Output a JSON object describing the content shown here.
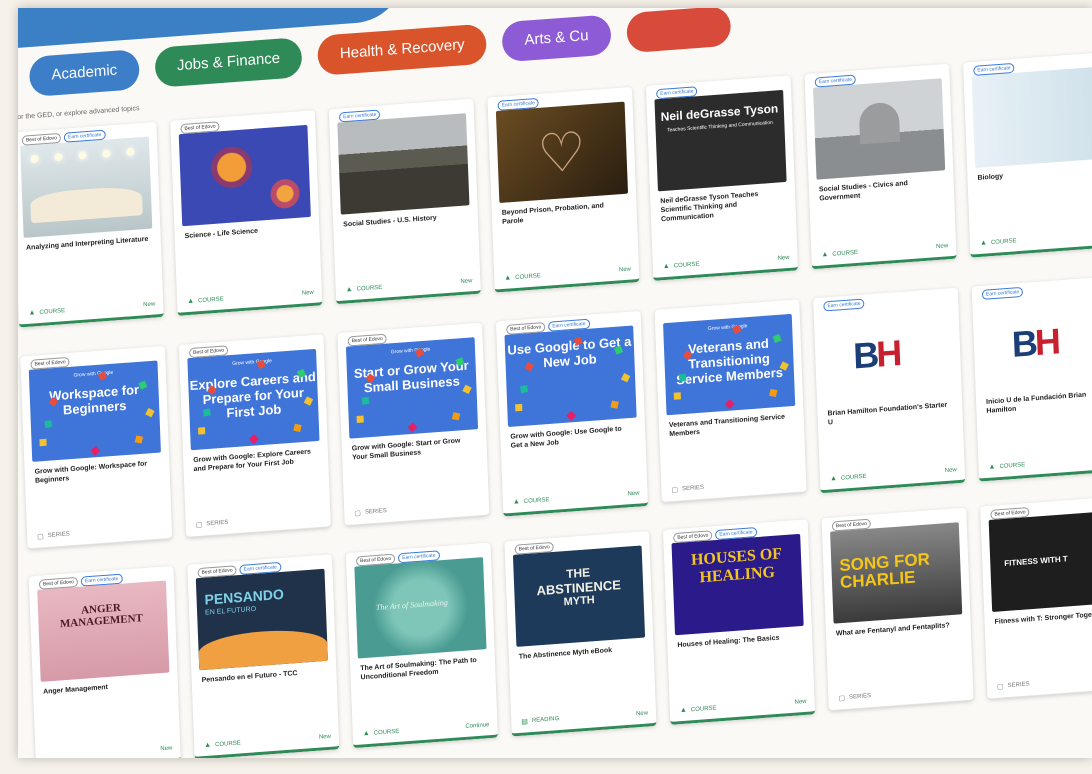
{
  "categories": [
    "Academic",
    "Jobs & Finance",
    "Health & Recovery",
    "Arts & Cu",
    ""
  ],
  "hint": "r for the GED, or explore advanced topics",
  "row1": [
    {
      "badges": [
        "Best of Edovo",
        "Earn certificate"
      ],
      "title": "Analyzing and Interpreting Literature",
      "type": "COURSE",
      "flag": "New",
      "thumb": "book"
    },
    {
      "badges": [
        "Best of Edovo"
      ],
      "title": "Science - Life Science",
      "type": "COURSE",
      "flag": "New",
      "thumb": "life"
    },
    {
      "badges": [
        "Earn certificate"
      ],
      "title": "Social Studies - U.S. History",
      "type": "COURSE",
      "flag": "New",
      "thumb": "crowd"
    },
    {
      "badges": [
        "Earn certificate"
      ],
      "title": "Beyond Prison, Probation, and Parole",
      "type": "COURSE",
      "flag": "New",
      "thumb": "hearts"
    },
    {
      "badges": [
        "Earn certificate"
      ],
      "title": "Neil deGrasse Tyson Teaches Scientific Thinking and Communication",
      "type": "COURSE",
      "flag": "New",
      "thumb": "tyson",
      "thumb_title": "Neil deGrasse Tyson",
      "thumb_sub": "Teaches Scientific Thinking and Communication"
    },
    {
      "badges": [
        "Earn certificate"
      ],
      "title": "Social Studies - Civics and Government",
      "type": "COURSE",
      "flag": "New",
      "thumb": "capitol"
    },
    {
      "badges": [
        "Earn certificate"
      ],
      "title": "Biology",
      "type": "COURSE",
      "flag": "",
      "thumb": "lab"
    }
  ],
  "row2": [
    {
      "badges": [
        "Best of Edovo"
      ],
      "title": "Grow with Google: Workspace for Beginners",
      "type": "SERIES",
      "flag": "",
      "thumb": "google",
      "g_head": "Grow with Google",
      "g_title": "Workspace for Beginners"
    },
    {
      "badges": [
        "Best of Edovo"
      ],
      "title": "Grow with Google: Explore Careers and Prepare for Your First Job",
      "type": "SERIES",
      "flag": "",
      "thumb": "google",
      "g_head": "Grow with Google",
      "g_title": "Explore Careers and Prepare for Your First Job"
    },
    {
      "badges": [
        "Best of Edovo"
      ],
      "title": "Grow with Google: Start or Grow Your Small Business",
      "type": "SERIES",
      "flag": "",
      "thumb": "google",
      "g_head": "Grow with Google",
      "g_title": "Start or Grow Your Small Business"
    },
    {
      "badges": [
        "Best of Edovo",
        "Earn certificate"
      ],
      "title": "Grow with Google: Use Google to Get a New Job",
      "type": "COURSE",
      "flag": "New",
      "thumb": "google",
      "g_head": "",
      "g_title": "Use Google to Get a New Job"
    },
    {
      "badges": [],
      "title": "Veterans and Transitioning Service Members",
      "type": "SERIES",
      "flag": "",
      "thumb": "google",
      "g_head": "Grow with Google",
      "g_title": "Veterans and Transitioning Service Members"
    },
    {
      "badges": [
        "Earn certificate"
      ],
      "title": "Brian Hamilton Foundation's Starter U",
      "type": "COURSE",
      "flag": "New",
      "thumb": "bh"
    },
    {
      "badges": [
        "Earn certificate"
      ],
      "title": "Inicio U de la Fundación Brian Hamilton",
      "type": "COURSE",
      "flag": "",
      "thumb": "bh"
    }
  ],
  "row3": [
    {
      "badges": [
        "Best of Edovo",
        "Earn certificate"
      ],
      "title": "Anger Management",
      "type": "",
      "flag": "New",
      "thumb": "anger",
      "thumb_title": "ANGER MANAGEMENT"
    },
    {
      "badges": [
        "Best of Edovo",
        "Earn certificate"
      ],
      "title": "Pensando en el Futuro - TCC",
      "type": "COURSE",
      "flag": "New",
      "thumb": "futuro",
      "thumb_title": "PENSANDO",
      "thumb_sub": "EN EL FUTURO"
    },
    {
      "badges": [
        "Best of Edovo",
        "Earn certificate"
      ],
      "title": "The Art of Soulmaking: The Path to Unconditional Freedom",
      "type": "COURSE",
      "flag": "Continue",
      "thumb": "soul",
      "thumb_title": "The Art of Soulmaking"
    },
    {
      "badges": [
        "Best of Edovo"
      ],
      "title": "The Abstinence Myth eBook",
      "type": "READING",
      "flag": "New",
      "thumb": "myth",
      "thumb_title": "THE",
      "thumb_sub": "ABSTINENCE",
      "thumb_sub2": "MYTH"
    },
    {
      "badges": [
        "Best of Edovo",
        "Earn certificate"
      ],
      "title": "Houses of Healing: The Basics",
      "type": "COURSE",
      "flag": "New",
      "thumb": "houses",
      "thumb_title": "HOUSES OF HEALING"
    },
    {
      "badges": [
        "Best of Edovo"
      ],
      "title": "What are Fentanyl and Fentaplits?",
      "type": "SERIES",
      "flag": "",
      "thumb": "charlie",
      "thumb_title": "SONG FOR CHARLIE"
    },
    {
      "badges": [
        "Best of Edovo"
      ],
      "title": "Fitness with T: Stronger Toget",
      "type": "SERIES",
      "flag": "",
      "thumb": "fit",
      "thumb_title": "FITNESS WITH T"
    }
  ],
  "colors": {
    "course_green": "#2e8b57",
    "cert_blue": "#3a7bd5",
    "google_blue": "#3f74d8"
  }
}
